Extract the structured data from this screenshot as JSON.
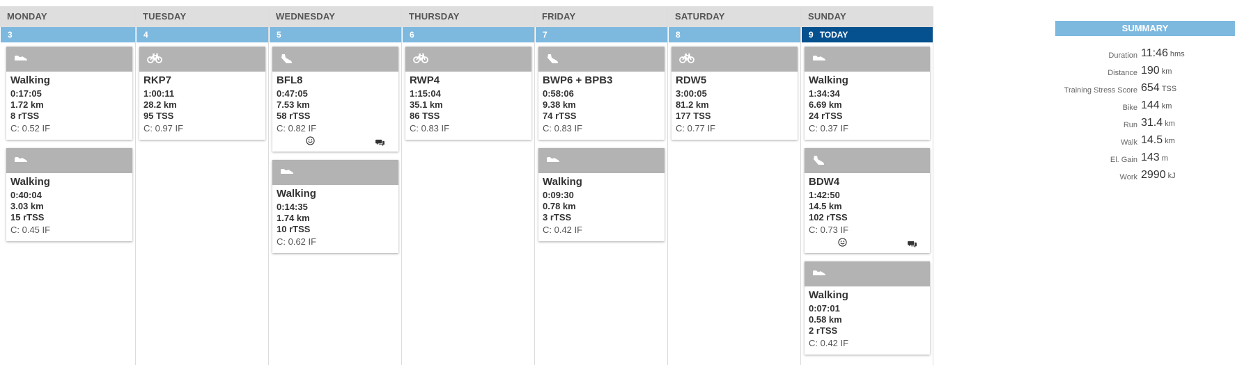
{
  "summary": {
    "title": "SUMMARY",
    "rows": [
      {
        "label": "Duration",
        "value": "11:46",
        "unit": "hms"
      },
      {
        "label": "Distance",
        "value": "190",
        "unit": "km"
      },
      {
        "label": "Training Stress Score",
        "value": "654",
        "unit": "TSS"
      },
      {
        "label": "Bike",
        "value": "144",
        "unit": "km"
      },
      {
        "label": "Run",
        "value": "31.4",
        "unit": "km"
      },
      {
        "label": "Walk",
        "value": "14.5",
        "unit": "km"
      },
      {
        "label": "El. Gain",
        "value": "143",
        "unit": "m"
      },
      {
        "label": "Work",
        "value": "2990",
        "unit": "kJ"
      }
    ]
  },
  "days": [
    {
      "name": "MONDAY",
      "date": "3",
      "today": false,
      "today_label": "",
      "workouts": [
        {
          "sport": "walk",
          "icon": "shoe-icon",
          "title": "Walking",
          "duration": "0:17:05",
          "distance": "1.72 km",
          "tss": "8 rTSS",
          "if": "C: 0.52 IF",
          "has_feedback": false
        },
        {
          "sport": "walk",
          "icon": "shoe-icon",
          "title": "Walking",
          "duration": "0:40:04",
          "distance": "3.03 km",
          "tss": "15 rTSS",
          "if": "C: 0.45 IF",
          "has_feedback": false
        }
      ]
    },
    {
      "name": "TUESDAY",
      "date": "4",
      "today": false,
      "today_label": "",
      "workouts": [
        {
          "sport": "bike",
          "icon": "bike-icon",
          "title": "RKP7",
          "duration": "1:00:11",
          "distance": "28.2 km",
          "tss": "95 TSS",
          "if": "C: 0.97 IF",
          "has_feedback": false
        }
      ]
    },
    {
      "name": "WEDNESDAY",
      "date": "5",
      "today": false,
      "today_label": "",
      "workouts": [
        {
          "sport": "run",
          "icon": "running-shoe-icon",
          "title": "BFL8",
          "duration": "0:47:05",
          "distance": "7.53 km",
          "tss": "58 rTSS",
          "if": "C: 0.82 IF",
          "has_feedback": true
        },
        {
          "sport": "walk",
          "icon": "shoe-icon",
          "title": "Walking",
          "duration": "0:14:35",
          "distance": "1.74 km",
          "tss": "10 rTSS",
          "if": "C: 0.62 IF",
          "has_feedback": false
        }
      ]
    },
    {
      "name": "THURSDAY",
      "date": "6",
      "today": false,
      "today_label": "",
      "workouts": [
        {
          "sport": "bike",
          "icon": "bike-icon",
          "title": "RWP4",
          "duration": "1:15:04",
          "distance": "35.1 km",
          "tss": "86 TSS",
          "if": "C: 0.83 IF",
          "has_feedback": false
        }
      ]
    },
    {
      "name": "FRIDAY",
      "date": "7",
      "today": false,
      "today_label": "",
      "workouts": [
        {
          "sport": "run",
          "icon": "running-shoe-icon",
          "title": "BWP6 + BPB3",
          "duration": "0:58:06",
          "distance": "9.38 km",
          "tss": "74 rTSS",
          "if": "C: 0.83 IF",
          "has_feedback": false
        },
        {
          "sport": "walk",
          "icon": "shoe-icon",
          "title": "Walking",
          "duration": "0:09:30",
          "distance": "0.78 km",
          "tss": "3 rTSS",
          "if": "C: 0.42 IF",
          "has_feedback": false
        }
      ]
    },
    {
      "name": "SATURDAY",
      "date": "8",
      "today": false,
      "today_label": "",
      "workouts": [
        {
          "sport": "bike",
          "icon": "bike-icon",
          "title": "RDW5",
          "duration": "3:00:05",
          "distance": "81.2 km",
          "tss": "177 TSS",
          "if": "C: 0.77 IF",
          "has_feedback": false
        }
      ]
    },
    {
      "name": "SUNDAY",
      "date": "9",
      "today": true,
      "today_label": "TODAY",
      "workouts": [
        {
          "sport": "walk",
          "icon": "shoe-icon",
          "title": "Walking",
          "duration": "1:34:34",
          "distance": "6.69 km",
          "tss": "24 rTSS",
          "if": "C: 0.37 IF",
          "has_feedback": false
        },
        {
          "sport": "run",
          "icon": "running-shoe-icon",
          "title": "BDW4",
          "duration": "1:42:50",
          "distance": "14.5 km",
          "tss": "102 rTSS",
          "if": "C: 0.73 IF",
          "has_feedback": true
        },
        {
          "sport": "walk",
          "icon": "shoe-icon",
          "title": "Walking",
          "duration": "0:07:01",
          "distance": "0.58 km",
          "tss": "2 rTSS",
          "if": "C: 0.42 IF",
          "has_feedback": false
        }
      ]
    }
  ]
}
